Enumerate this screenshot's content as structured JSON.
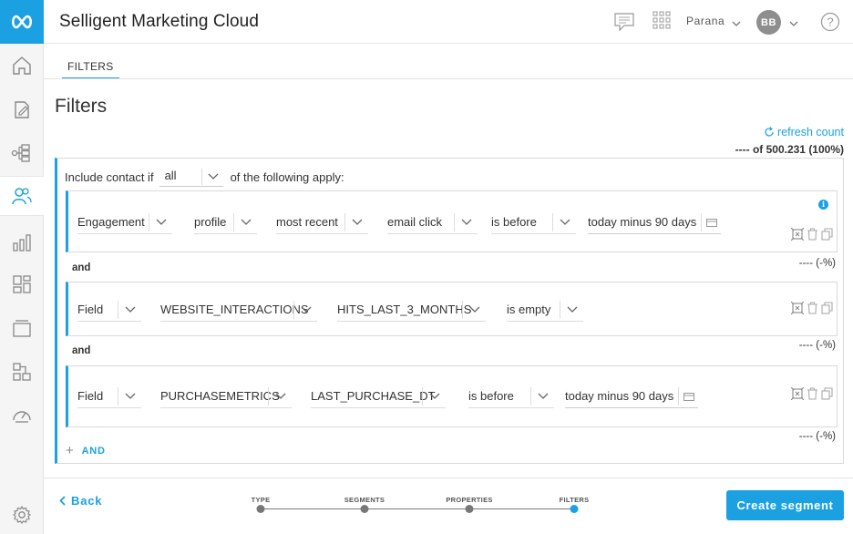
{
  "app": {
    "title": "Selligent Marketing Cloud",
    "org": "Parana",
    "user_initials": "BB"
  },
  "tabs": [
    {
      "label": "FILTERS"
    }
  ],
  "page": {
    "title": "Filters",
    "refresh_label": "refresh count",
    "total_count": "---- of 500.231 (100%)"
  },
  "group": {
    "include_prefix": "Include contact if",
    "match_value": "all",
    "include_suffix": "of the following apply:",
    "add_label": "AND",
    "rules": [
      {
        "fields": [
          "Engagement",
          "profile",
          "most recent",
          "email click",
          "is before"
        ],
        "date_value": "today minus 90 days",
        "count": "---- (-%)",
        "connector": "and"
      },
      {
        "fields": [
          "Field",
          "WEBSITE_INTERACTIONS",
          "HITS_LAST_3_MONTHS",
          "is empty"
        ],
        "count": "---- (-%)",
        "connector": "and"
      },
      {
        "fields": [
          "Field",
          "PURCHASEMETRICS",
          "LAST_PURCHASE_DT",
          "is before"
        ],
        "date_value": "today minus 90 days",
        "count": "---- (-%)"
      }
    ]
  },
  "footer": {
    "back_label": "Back",
    "create_label": "Create segment",
    "steps": [
      "TYPE",
      "SEGMENTS",
      "PROPERTIES",
      "FILTERS"
    ],
    "active_step": 3
  },
  "colors": {
    "accent": "#1ba1e2",
    "rail_bg": "#f5f5f5"
  },
  "icons": {
    "rail": [
      "logo-icon",
      "home-icon",
      "edit-icon",
      "journey-icon",
      "audience-icon",
      "reports-icon",
      "content-icon",
      "layers-icon",
      "components-icon",
      "dashboard-icon",
      "settings-icon"
    ],
    "header": [
      "chat-icon",
      "apps-grid-icon",
      "chevron-down-icon",
      "help-icon"
    ]
  }
}
